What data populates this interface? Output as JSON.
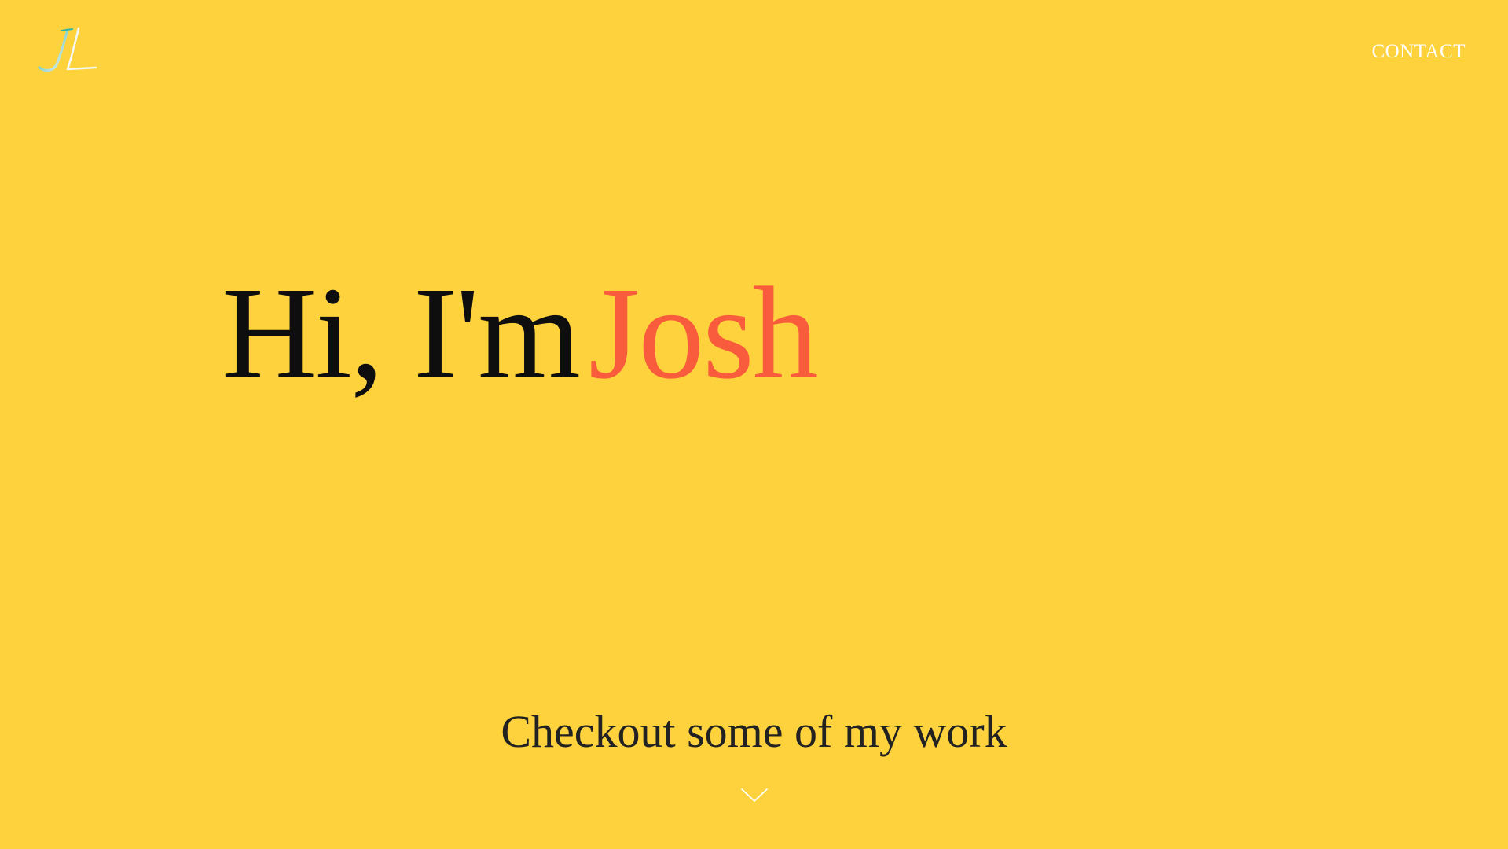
{
  "colors": {
    "background": "#FED23D",
    "name_accent": "#F95B3D",
    "heading_text": "#0E0E0E",
    "nav_text": "#FFFFFF",
    "logo_teal": "#2BB3A5"
  },
  "header": {
    "logo_text": "JL",
    "logo_icon": "jl-monogram-logo",
    "nav": {
      "contact_label": "CONTACT"
    }
  },
  "hero": {
    "greeting": "Hi, I'm",
    "name": "Josh"
  },
  "cta": {
    "label": "Checkout some of my work",
    "icon": "chevron-down-icon"
  }
}
